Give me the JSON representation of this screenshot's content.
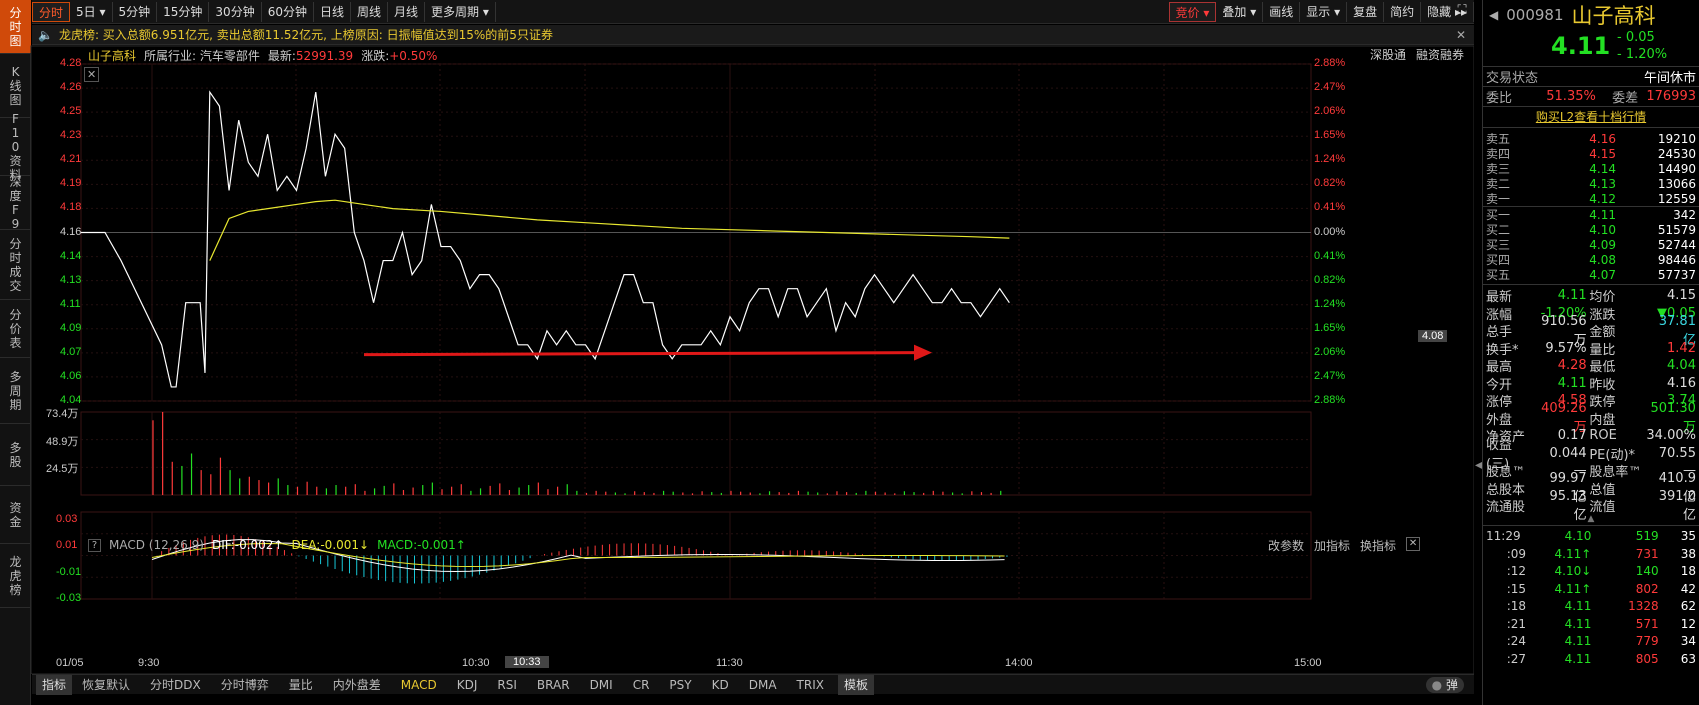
{
  "sidebar": {
    "tabs": [
      {
        "label": "分时图",
        "active": true
      },
      {
        "label": "K线图"
      },
      {
        "label": "F10资料"
      },
      {
        "label": "深度F9"
      },
      {
        "label": "分时成交"
      },
      {
        "label": "分价表"
      },
      {
        "label": "多周期"
      },
      {
        "label": "多股"
      },
      {
        "label": "资金"
      },
      {
        "label": "龙虎榜"
      }
    ]
  },
  "toolbar": {
    "periods": [
      "分时",
      "5日 ▾",
      "5分钟",
      "15分钟",
      "30分钟",
      "60分钟",
      "日线",
      "周线",
      "月线",
      "更多周期 ▾"
    ],
    "right_buttons": [
      "竞价 ▾",
      "叠加 ▾",
      "画线",
      "显示 ▾",
      "复盘",
      "简约",
      "隐藏 ▸▸"
    ]
  },
  "notice": {
    "text": "龙虎榜: 买入总额6.951亿元, 卖出总额11.52亿元, 上榜原因: 日振幅值达到15%的前5只证券"
  },
  "chart_header": {
    "name": "山子高科",
    "industry_label": "所属行业: 汽车零部件",
    "latest_label": "最新:",
    "latest_value": "52991.39",
    "change_label": "涨跌:",
    "change_value": "+0.50%",
    "right_links": [
      "深股通",
      "融资融券"
    ]
  },
  "price_axis": {
    "left": [
      "4.28",
      "4.26",
      "4.25",
      "4.23",
      "4.21",
      "4.19",
      "4.18",
      "4.16",
      "4.14",
      "4.13",
      "4.11",
      "4.09",
      "4.07",
      "4.06",
      "4.04"
    ],
    "right": [
      "2.88%",
      "2.47%",
      "2.06%",
      "1.65%",
      "1.24%",
      "0.82%",
      "0.41%",
      "0.00%",
      "0.41%",
      "0.82%",
      "1.24%",
      "1.65%",
      "2.06%",
      "2.47%",
      "2.88%"
    ],
    "price_tag": "4.08"
  },
  "volume_axis": [
    "73.4万",
    "48.9万",
    "24.5万"
  ],
  "macd": {
    "label": "MACD (12,26,9)",
    "dif": "DIF:-0.002↑",
    "dea": "DEA:-0.001↓",
    "macd": "MACD:-0.001↑",
    "links": [
      "改参数",
      "加指标",
      "换指标"
    ],
    "axis": [
      "0.03",
      "0.01",
      "-0.01",
      "-0.03"
    ]
  },
  "time_axis": {
    "labels": [
      "01/05",
      "9:30",
      "10:30",
      "11:30",
      "14:00",
      "15:00"
    ],
    "cursor_label": "10:33"
  },
  "chart_data": {
    "type": "line",
    "title": "山子高科 分时",
    "x_unit": "minutes from 9:30",
    "prev_close": 4.16,
    "ylim": [
      4.04,
      4.28
    ],
    "series": [
      {
        "name": "price",
        "points": [
          [
            -6,
            4.16
          ],
          [
            -3,
            4.16
          ],
          [
            -1,
            4.14
          ],
          [
            2,
            4.08
          ],
          [
            4,
            4.05
          ],
          [
            5,
            4.05
          ],
          [
            7,
            4.11
          ],
          [
            9,
            4.11
          ],
          [
            10,
            4.11
          ],
          [
            11,
            4.06
          ],
          [
            12,
            4.26
          ],
          [
            14,
            4.25
          ],
          [
            16,
            4.19
          ],
          [
            18,
            4.24
          ],
          [
            20,
            4.21
          ],
          [
            22,
            4.2
          ],
          [
            24,
            4.23
          ],
          [
            26,
            4.19
          ],
          [
            28,
            4.2
          ],
          [
            30,
            4.19
          ],
          [
            32,
            4.22
          ],
          [
            34,
            4.26
          ],
          [
            36,
            4.2
          ],
          [
            38,
            4.23
          ],
          [
            40,
            4.22
          ],
          [
            42,
            4.16
          ],
          [
            44,
            4.14
          ],
          [
            46,
            4.11
          ],
          [
            48,
            4.14
          ],
          [
            50,
            4.14
          ],
          [
            52,
            4.16
          ],
          [
            54,
            4.13
          ],
          [
            56,
            4.14
          ],
          [
            58,
            4.18
          ],
          [
            60,
            4.15
          ],
          [
            62,
            4.15
          ],
          [
            64,
            4.14
          ],
          [
            66,
            4.12
          ],
          [
            68,
            4.13
          ],
          [
            70,
            4.13
          ],
          [
            72,
            4.12
          ],
          [
            74,
            4.1
          ],
          [
            76,
            4.08
          ],
          [
            78,
            4.08
          ],
          [
            80,
            4.07
          ],
          [
            82,
            4.09
          ],
          [
            84,
            4.08
          ],
          [
            86,
            4.09
          ],
          [
            88,
            4.08
          ],
          [
            90,
            4.08
          ],
          [
            92,
            4.07
          ],
          [
            94,
            4.09
          ],
          [
            96,
            4.11
          ],
          [
            98,
            4.13
          ],
          [
            100,
            4.13
          ],
          [
            102,
            4.11
          ],
          [
            104,
            4.11
          ],
          [
            106,
            4.08
          ],
          [
            108,
            4.07
          ],
          [
            110,
            4.08
          ],
          [
            112,
            4.08
          ],
          [
            114,
            4.08
          ],
          [
            116,
            4.09
          ],
          [
            118,
            4.08
          ],
          [
            120,
            4.1
          ],
          [
            122,
            4.09
          ],
          [
            124,
            4.11
          ],
          [
            126,
            4.12
          ],
          [
            128,
            4.12
          ],
          [
            130,
            4.1
          ],
          [
            132,
            4.12
          ],
          [
            134,
            4.12
          ],
          [
            136,
            4.1
          ],
          [
            138,
            4.11
          ],
          [
            140,
            4.12
          ],
          [
            142,
            4.09
          ],
          [
            144,
            4.11
          ],
          [
            146,
            4.1
          ],
          [
            148,
            4.12
          ],
          [
            150,
            4.13
          ],
          [
            152,
            4.12
          ],
          [
            154,
            4.11
          ],
          [
            156,
            4.12
          ],
          [
            158,
            4.13
          ],
          [
            160,
            4.12
          ],
          [
            162,
            4.11
          ],
          [
            164,
            4.11
          ],
          [
            166,
            4.12
          ],
          [
            168,
            4.11
          ],
          [
            170,
            4.11
          ],
          [
            172,
            4.1
          ],
          [
            174,
            4.11
          ],
          [
            176,
            4.12
          ],
          [
            178,
            4.11
          ]
        ]
      },
      {
        "name": "avg",
        "points": [
          [
            12,
            4.14
          ],
          [
            16,
            4.17
          ],
          [
            20,
            4.175
          ],
          [
            26,
            4.178
          ],
          [
            30,
            4.18
          ],
          [
            34,
            4.182
          ],
          [
            38,
            4.183
          ],
          [
            44,
            4.18
          ],
          [
            50,
            4.177
          ],
          [
            60,
            4.175
          ],
          [
            70,
            4.172
          ],
          [
            80,
            4.169
          ],
          [
            90,
            4.167
          ],
          [
            100,
            4.165
          ],
          [
            110,
            4.163
          ],
          [
            120,
            4.162
          ],
          [
            130,
            4.161
          ],
          [
            140,
            4.16
          ],
          [
            150,
            4.159
          ],
          [
            160,
            4.158
          ],
          [
            170,
            4.157
          ],
          [
            178,
            4.156
          ]
        ]
      }
    ]
  },
  "quote": {
    "code": "000981",
    "name": "山子高科",
    "price": "4.11",
    "change": "- 0.05",
    "change_pct": "- 1.20%",
    "status_label": "交易状态",
    "status_value": "午间休市",
    "weibi_label": "委比",
    "weibi_value": "51.35%",
    "weicha_label": "委差",
    "weicha_value": "176993",
    "l2_link": "购买L2查看十档行情",
    "asks": [
      {
        "label": "卖五",
        "price": "4.16",
        "vol": "19210"
      },
      {
        "label": "卖四",
        "price": "4.15",
        "vol": "24530"
      },
      {
        "label": "卖三",
        "price": "4.14",
        "vol": "14490"
      },
      {
        "label": "卖二",
        "price": "4.13",
        "vol": "13066"
      },
      {
        "label": "卖一",
        "price": "4.12",
        "vol": "12559"
      }
    ],
    "bids": [
      {
        "label": "买一",
        "price": "4.11",
        "vol": "342"
      },
      {
        "label": "买二",
        "price": "4.10",
        "vol": "51579"
      },
      {
        "label": "买三",
        "price": "4.09",
        "vol": "52744"
      },
      {
        "label": "买四",
        "price": "4.08",
        "vol": "98446"
      },
      {
        "label": "买五",
        "price": "4.07",
        "vol": "57737"
      }
    ],
    "stats": [
      [
        "最新",
        "4.11",
        "均价",
        "4.15"
      ],
      [
        "涨幅",
        "-1.20%",
        "涨跌",
        "▼0.05"
      ],
      [
        "总手",
        "910.56万",
        "金额",
        "37.81亿"
      ],
      [
        "换手*",
        "9.57%",
        "量比",
        "1.42"
      ],
      [
        "最高",
        "4.28",
        "最低",
        "4.04"
      ],
      [
        "今开",
        "4.11",
        "昨收",
        "4.16"
      ],
      [
        "涨停",
        "4.58",
        "跌停",
        "3.74"
      ],
      [
        "外盘",
        "409.26万",
        "内盘",
        "501.30万"
      ],
      [
        "净资产",
        "0.17",
        "ROE",
        "34.00%"
      ],
      [
        "收益(三)",
        "0.044",
        "PE(动)*",
        "70.55"
      ],
      [
        "股息™",
        "—",
        "股息率™",
        "—"
      ],
      [
        "总股本",
        "99.97亿",
        "总值",
        "410.9亿"
      ],
      [
        "流通股",
        "95.13亿",
        "流值",
        "391.0亿"
      ]
    ],
    "ticks": [
      {
        "time": "11:29",
        "price": "4.10",
        "vol": "519",
        "n": "35"
      },
      {
        "time": ":09",
        "price": "4.11↑",
        "vol": "731",
        "n": "38"
      },
      {
        "time": ":12",
        "price": "4.10↓",
        "vol": "140",
        "n": "18"
      },
      {
        "time": ":15",
        "price": "4.11↑",
        "vol": "802",
        "n": "42"
      },
      {
        "time": ":18",
        "price": "4.11",
        "vol": "1328",
        "n": "62"
      },
      {
        "time": ":21",
        "price": "4.11",
        "vol": "571",
        "n": "12"
      },
      {
        "time": ":24",
        "price": "4.11",
        "vol": "779",
        "n": "34"
      },
      {
        "time": ":27",
        "price": "4.11",
        "vol": "805",
        "n": "63"
      }
    ]
  },
  "bottom_tabs": [
    "指标",
    "恢复默认",
    "分时DDX",
    "分时博弈",
    "量比",
    "内外盘差",
    "MACD",
    "KDJ",
    "RSI",
    "BRAR",
    "DMI",
    "CR",
    "PSY",
    "KD",
    "DMA",
    "TRIX",
    "模板"
  ],
  "bottom_right": "弹",
  "colors": {
    "up": "#ff3a3a",
    "down": "#23e023",
    "avg": "#e8e830",
    "arrow": "#e01818"
  }
}
